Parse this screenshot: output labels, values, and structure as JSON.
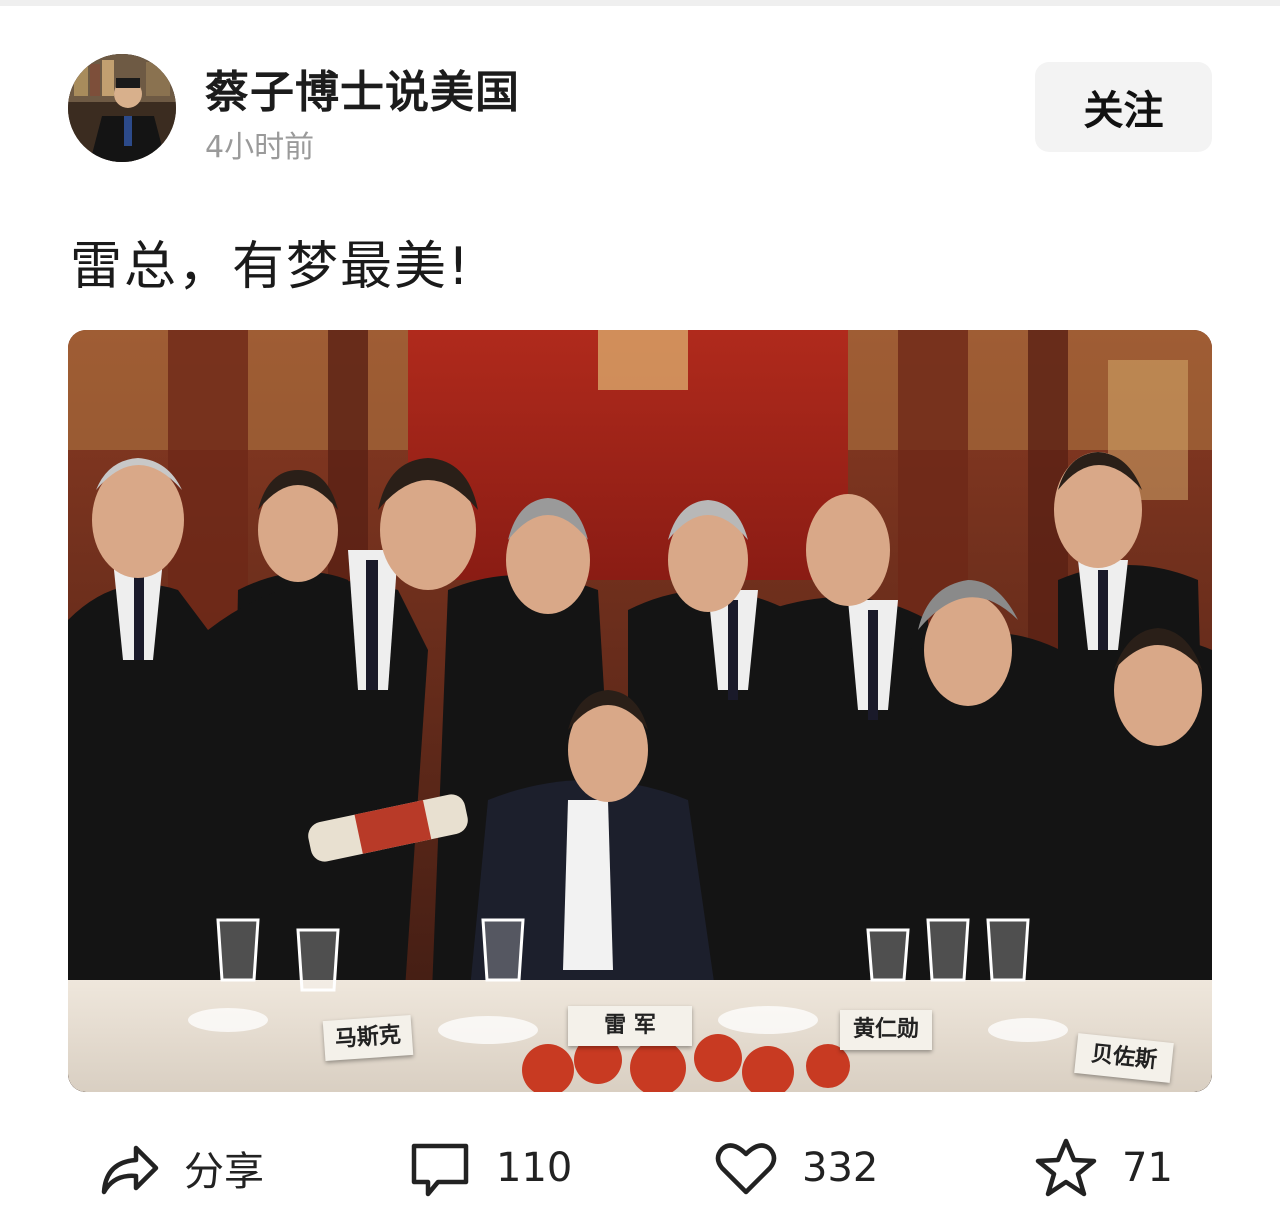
{
  "post": {
    "author": "蔡子博士说美国",
    "time": "4小时前",
    "follow_label": "关注",
    "text": "雷总，有梦最美!"
  },
  "photo": {
    "nameplates": [
      "马斯克",
      "雷 军",
      "黄仁勋",
      "贝佐斯"
    ]
  },
  "actions": {
    "share_label": "分享",
    "comments": "110",
    "likes": "332",
    "favorites": "71"
  },
  "icons": [
    "share-icon",
    "comment-icon",
    "heart-icon",
    "star-icon"
  ],
  "colors": {
    "background": "#ffffff",
    "follow_bg": "#f3f3f3",
    "time_text": "#9a9a9a"
  }
}
